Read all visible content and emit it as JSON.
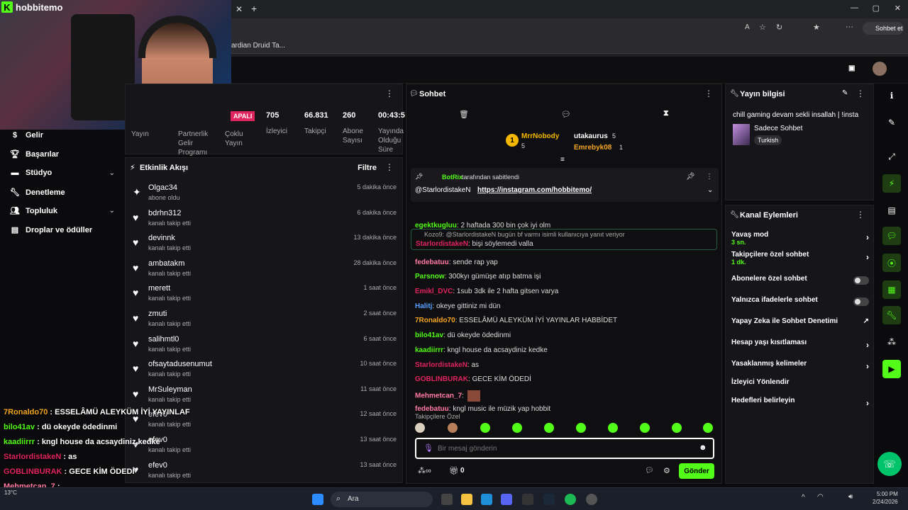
{
  "browser": {
    "bookmark_label": "ardian Druid Ta...",
    "copilot_label": "Sohbet et"
  },
  "brand": {
    "name": "hobbitemo",
    "accent": "#53fc18"
  },
  "nav": [
    {
      "label": "Gelir",
      "icon": "dollar-icon"
    },
    {
      "label": "Başarılar",
      "icon": "trophy-icon"
    },
    {
      "label": "Stüdyo",
      "icon": "studio-icon"
    },
    {
      "label": "Denetleme",
      "icon": "wrench-icon"
    },
    {
      "label": "Topluluk",
      "icon": "people-icon"
    },
    {
      "label": "Droplar ve ödüller",
      "icon": "chart-icon"
    }
  ],
  "stats": {
    "badge": "APALI",
    "viewers": "705",
    "viewers_label": "İzleyici",
    "followers": "66.831",
    "followers_label": "Takipçi",
    "subs": "260",
    "subs_label": "Abone Sayısı",
    "duration": "00:43:5",
    "duration_label": "Yayında Olduğu Süre",
    "stream_label": "Yayın",
    "partner_label": "Partnerlik Gelir Programı",
    "multi_label": "Çoklu Yayın"
  },
  "activity": {
    "title": "Etkinlik Akışı",
    "filter": "Filtre",
    "items": [
      {
        "name": "Olgac34",
        "sub": "abone oldu",
        "time": "5 dakika önce"
      },
      {
        "name": "bdrhn312",
        "sub": "kanalı takip etti",
        "time": "6 dakika önce"
      },
      {
        "name": "devinnk",
        "sub": "kanalı takip etti",
        "time": "13 dakika önce"
      },
      {
        "name": "ambatakm",
        "sub": "kanalı takip etti",
        "time": "28 dakika önce"
      },
      {
        "name": "merett",
        "sub": "kanalı takip etti",
        "time": "1 saat önce"
      },
      {
        "name": "zmuti",
        "sub": "kanalı takip etti",
        "time": "2 saat önce"
      },
      {
        "name": "salihmtl0",
        "sub": "kanalı takip etti",
        "time": "6 saat önce"
      },
      {
        "name": "ofsaytadusenumut",
        "sub": "kanalı takip etti",
        "time": "10 saat önce"
      },
      {
        "name": "MrSuleyman",
        "sub": "kanalı takip etti",
        "time": "11 saat önce"
      },
      {
        "name": "efev0",
        "sub": "kanalı takip etti",
        "time": "12 saat önce"
      },
      {
        "name": "efev0",
        "sub": "kanalı takip etti",
        "time": "13 saat önce"
      },
      {
        "name": "efev0",
        "sub": "kanalı takip etti",
        "time": "13 saat önce"
      }
    ]
  },
  "chat": {
    "title": "Sohbet",
    "top": [
      {
        "name": "MrrNobody",
        "count": "5"
      },
      {
        "name": "utakaurus",
        "count": "5"
      },
      {
        "name": "Emrebyk08",
        "count": "1"
      }
    ],
    "pinned_by": "BotRix",
    "pinned_suffix": "tarafından sabitlendi",
    "pinned_user": "@StarlordistakeN",
    "pinned_link": "https://instagram.com/hobbitemo/",
    "messages": [
      {
        "user": "egektkugluu",
        "color": "#53fc18",
        "text": "2 haftada 300 bin çok iyi olm"
      },
      {
        "user": "StarlordistakeN",
        "color": "#e0245e",
        "text": "bişi söylemedi valla",
        "reply": "Kozo9: @StarlordistakeN bugün bf varmı isimli kullanıcıya yanıt veriyor"
      },
      {
        "user": "fedebatuu",
        "color": "#ff7aa2",
        "text": "sende rap yap"
      },
      {
        "user": "Parsnow",
        "color": "#53fc18",
        "text": "300kyı gümüşe atıp batma işi"
      },
      {
        "user": "Emikl_DVC",
        "color": "#e0245e",
        "text": "1sub 3dk ile 2 hafta gitsen varya"
      },
      {
        "user": "Halitj",
        "color": "#5aa0ff",
        "text": "okeye gittiniz mi dün"
      },
      {
        "user": "7Ronaldo70",
        "color": "#f5a623",
        "text": "ESSELÂMÜ ALEYKÜM İYİ YAYINLAR HABBİDET"
      },
      {
        "user": "bilo41av",
        "color": "#53fc18",
        "text": "dü okeyde ödedinmi"
      },
      {
        "user": "kaadiirrr",
        "color": "#53fc18",
        "text": "kngl house da acsaydiniz kedke"
      },
      {
        "user": "StarlordistakeN",
        "color": "#e0245e",
        "text": "as"
      },
      {
        "user": "GOBLINBURAK",
        "color": "#e0245e",
        "text": "GECE KİM ÖDEDİ"
      },
      {
        "user": "Mehmetcan_7",
        "color": "#ff7aa2",
        "text": ""
      },
      {
        "user": "fedebatuu",
        "color": "#ff7aa2",
        "text": "kngl music ile müzik yap hobbit"
      }
    ],
    "followers_only": "Takipçilere Özel",
    "input_placeholder": "Bir mesaj gönderin",
    "gift_count": "0",
    "send": "Gönder"
  },
  "info": {
    "title": "Yayın bilgisi",
    "stream_title": "chill gaming devam sekli insallah | !insta",
    "category": "Sadece Sohbet",
    "language": "Turkish"
  },
  "actions": {
    "title": "Kanal Eylemleri",
    "items": [
      {
        "label": "Yavaş mod",
        "sub": "3 sn.",
        "kind": "arrow"
      },
      {
        "label": "Takipçilere özel sohbet",
        "sub": "1 dk.",
        "kind": "arrow"
      },
      {
        "label": "Abonelere özel sohbet",
        "sub": "",
        "kind": "toggle"
      },
      {
        "label": "Yalnızca ifadelerle sohbet",
        "sub": "",
        "kind": "toggle"
      },
      {
        "label": "Yapay Zeka ile Sohbet Denetimi",
        "sub": "",
        "kind": "ext"
      },
      {
        "label": "Hesap yaşı kısıtlaması",
        "sub": "",
        "kind": "arrow"
      },
      {
        "label": "Yasaklanmış kelimeler",
        "sub": "",
        "kind": "arrow"
      },
      {
        "label": "İzleyici Yönlendir",
        "sub": "",
        "kind": "none"
      },
      {
        "label": "Hedefleri belirleyin",
        "sub": "",
        "kind": "arrow"
      }
    ]
  },
  "overlay": [
    {
      "user": "7Ronaldo70",
      "text": "ESSELÂMÜ ALEYKÜM İYİ YAYINLAF",
      "color": "#f5a623"
    },
    {
      "user": "bilo41av",
      "text": "dü okeyde ödedinmi",
      "color": "#53fc18"
    },
    {
      "user": "kaadiirrr",
      "text": "kngl house da acsaydiniz kedke",
      "color": "#53fc18"
    },
    {
      "user": "StarlordistakeN",
      "text": "as",
      "color": "#e0245e"
    },
    {
      "user": "GOBLINBURAK",
      "text": "GECE KİM ÖDEDİ",
      "color": "#e0245e"
    },
    {
      "user": "Mehmetcan_7",
      "text": "",
      "color": "#ff7aa2"
    },
    {
      "user": "fedebatuu",
      "text": "kngl music ile müzik yap hobbit",
      "color": "#ff7aa2"
    }
  ],
  "taskbar": {
    "search": "Ara",
    "temp": "13°C",
    "time": "5:00 PM",
    "date": "2/24/2026"
  }
}
